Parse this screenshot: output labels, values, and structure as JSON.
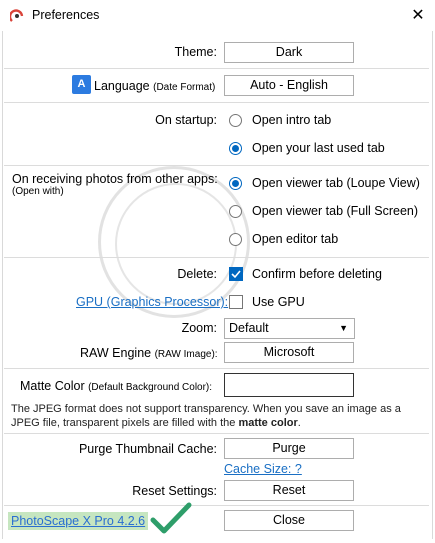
{
  "window": {
    "title": "Preferences",
    "close_glyph": "✕"
  },
  "theme": {
    "label": "Theme:",
    "value": "Dark"
  },
  "language": {
    "icon_text": "A",
    "label": "Language",
    "sub": "(Date Format)",
    "value": "Auto - English"
  },
  "startup": {
    "label": "On startup:",
    "options": [
      "Open intro tab",
      "Open your last used tab"
    ],
    "selected": 1
  },
  "receiving": {
    "label": "On receiving photos from other apps:",
    "sub": "(Open with)",
    "options": [
      "Open viewer tab (Loupe View)",
      "Open viewer tab (Full Screen)",
      "Open editor tab"
    ],
    "selected": 0
  },
  "delete": {
    "label": "Delete:",
    "checkbox_label": "Confirm before deleting",
    "checked": true
  },
  "gpu": {
    "label": "GPU (Graphics Processor):",
    "checkbox_label": "Use GPU",
    "checked": false
  },
  "zoom": {
    "label": "Zoom:",
    "value": "Default"
  },
  "raw": {
    "label": "RAW Engine",
    "sub": "(RAW Image):",
    "value": "Microsoft"
  },
  "matte": {
    "label": "Matte Color",
    "sub": "(Default Background Color):",
    "value": "",
    "swatch_color": "#ffffff"
  },
  "jpeg_note": {
    "text": "The JPEG format does not support transparency. When you save an image as a JPEG file, transparent pixels are filled with the",
    "bold": "matte color",
    "end": "."
  },
  "purge": {
    "label": "Purge Thumbnail Cache:",
    "button": "Purge",
    "link": "Cache Size: ?"
  },
  "reset": {
    "label": "Reset Settings:",
    "button": "Reset"
  },
  "footer": {
    "version": "PhotoScape X Pro 4.2.6",
    "close_button": "Close"
  },
  "colors": {
    "accent": "#0067c0",
    "link": "#1a6fc4",
    "highlight": "#c6e6c0",
    "checkmark": "#2e9e6a"
  }
}
